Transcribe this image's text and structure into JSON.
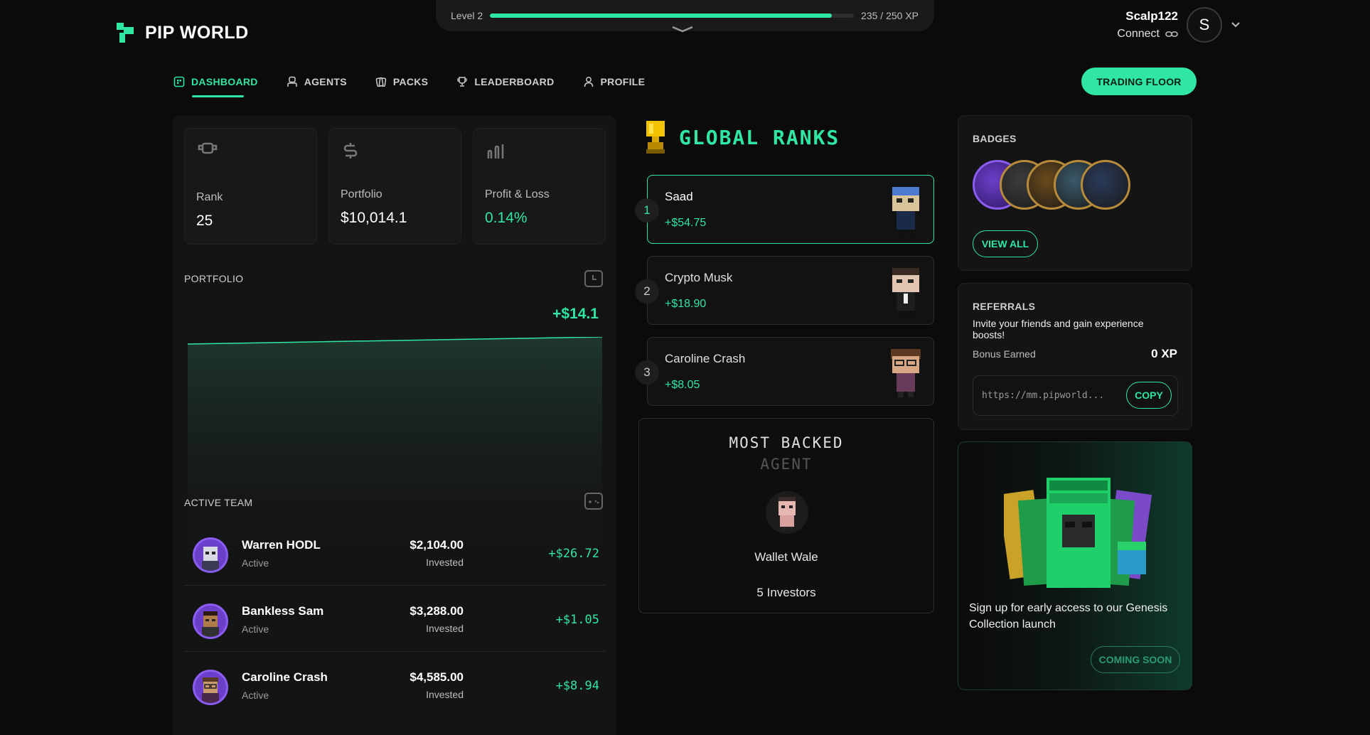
{
  "brand": {
    "name": "PIP WORLD"
  },
  "level": {
    "label": "Level 2",
    "xp_text": "235 / 250 XP",
    "progress": 0.94
  },
  "user": {
    "name": "Scalp122",
    "connect_label": "Connect",
    "avatar_letter": "S"
  },
  "nav": {
    "items": [
      {
        "label": "DASHBOARD",
        "icon": "dashboard-icon",
        "active": true
      },
      {
        "label": "AGENTS",
        "icon": "agents-icon",
        "active": false
      },
      {
        "label": "PACKS",
        "icon": "packs-icon",
        "active": false
      },
      {
        "label": "LEADERBOARD",
        "icon": "trophy-icon",
        "active": false
      },
      {
        "label": "PROFILE",
        "icon": "profile-icon",
        "active": false
      }
    ],
    "cta_label": "TRADING FLOOR"
  },
  "stats": {
    "rank": {
      "label": "Rank",
      "value": "25"
    },
    "portfolio": {
      "label": "Portfolio",
      "value": "$10,014.1"
    },
    "pnl": {
      "label": "Profit & Loss",
      "value": "0.14%"
    }
  },
  "portfolio_section": {
    "title": "PORTFOLIO",
    "delta": "+$14.1"
  },
  "active_team": {
    "title": "ACTIVE TEAM",
    "members": [
      {
        "name": "Warren HODL",
        "status": "Active",
        "invested": "$2,104.00",
        "invested_label": "Invested",
        "pnl": "+$26.72"
      },
      {
        "name": "Bankless Sam",
        "status": "Active",
        "invested": "$3,288.00",
        "invested_label": "Invested",
        "pnl": "+$1.05"
      },
      {
        "name": "Caroline Crash",
        "status": "Active",
        "invested": "$4,585.00",
        "invested_label": "Invested",
        "pnl": "+$8.94"
      }
    ]
  },
  "global_ranks": {
    "title": "GLOBAL RANKS",
    "entries": [
      {
        "rank": "1",
        "name": "Saad",
        "gain": "+$54.75"
      },
      {
        "rank": "2",
        "name": "Crypto Musk",
        "gain": "+$18.90"
      },
      {
        "rank": "3",
        "name": "Caroline Crash",
        "gain": "+$8.05"
      }
    ]
  },
  "most_backed": {
    "title": "MOST BACKED",
    "subtitle": "AGENT",
    "name": "Wallet Wale",
    "investors": "5 Investors"
  },
  "badges": {
    "title": "BADGES",
    "view_all": "VIEW ALL"
  },
  "referrals": {
    "title": "REFERRALS",
    "text": "Invite your friends and gain experience boosts!",
    "bonus_label": "Bonus Earned",
    "bonus_value": "0 XP",
    "link": "https://mm.pipworld...",
    "copy_label": "COPY"
  },
  "genesis": {
    "text": "Sign up for early access to our Genesis Collection launch",
    "button": "COMING SOON"
  },
  "colors": {
    "accent": "#30e6a3",
    "background": "#0b0b0b",
    "panel": "#141414"
  }
}
